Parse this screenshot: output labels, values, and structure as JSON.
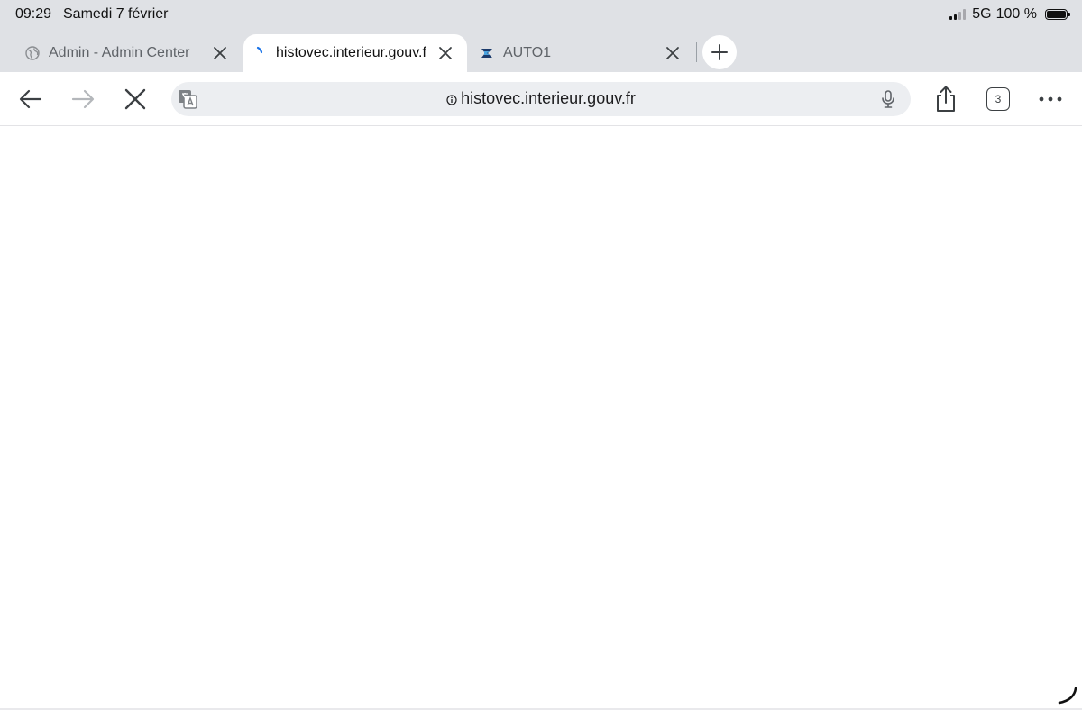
{
  "status_bar": {
    "time": "09:29",
    "date": "Samedi 7 février",
    "network": "5G",
    "battery": "100 %"
  },
  "tabs": [
    {
      "title": "Admin - Admin Center",
      "favicon": "globe-icon",
      "active": false
    },
    {
      "title": "histovec.interieur.gouv.f",
      "favicon": "loading-spinner-icon",
      "active": true
    },
    {
      "title": "AUTO1",
      "favicon": "auto1-logo-icon",
      "active": false
    }
  ],
  "toolbar": {
    "url": "histovec.interieur.gouv.fr",
    "tab_count": "3"
  },
  "colors": {
    "chrome_bg": "#dfe1e5",
    "omnibox_bg": "#eceef1",
    "spinner": "#1a73e8"
  }
}
